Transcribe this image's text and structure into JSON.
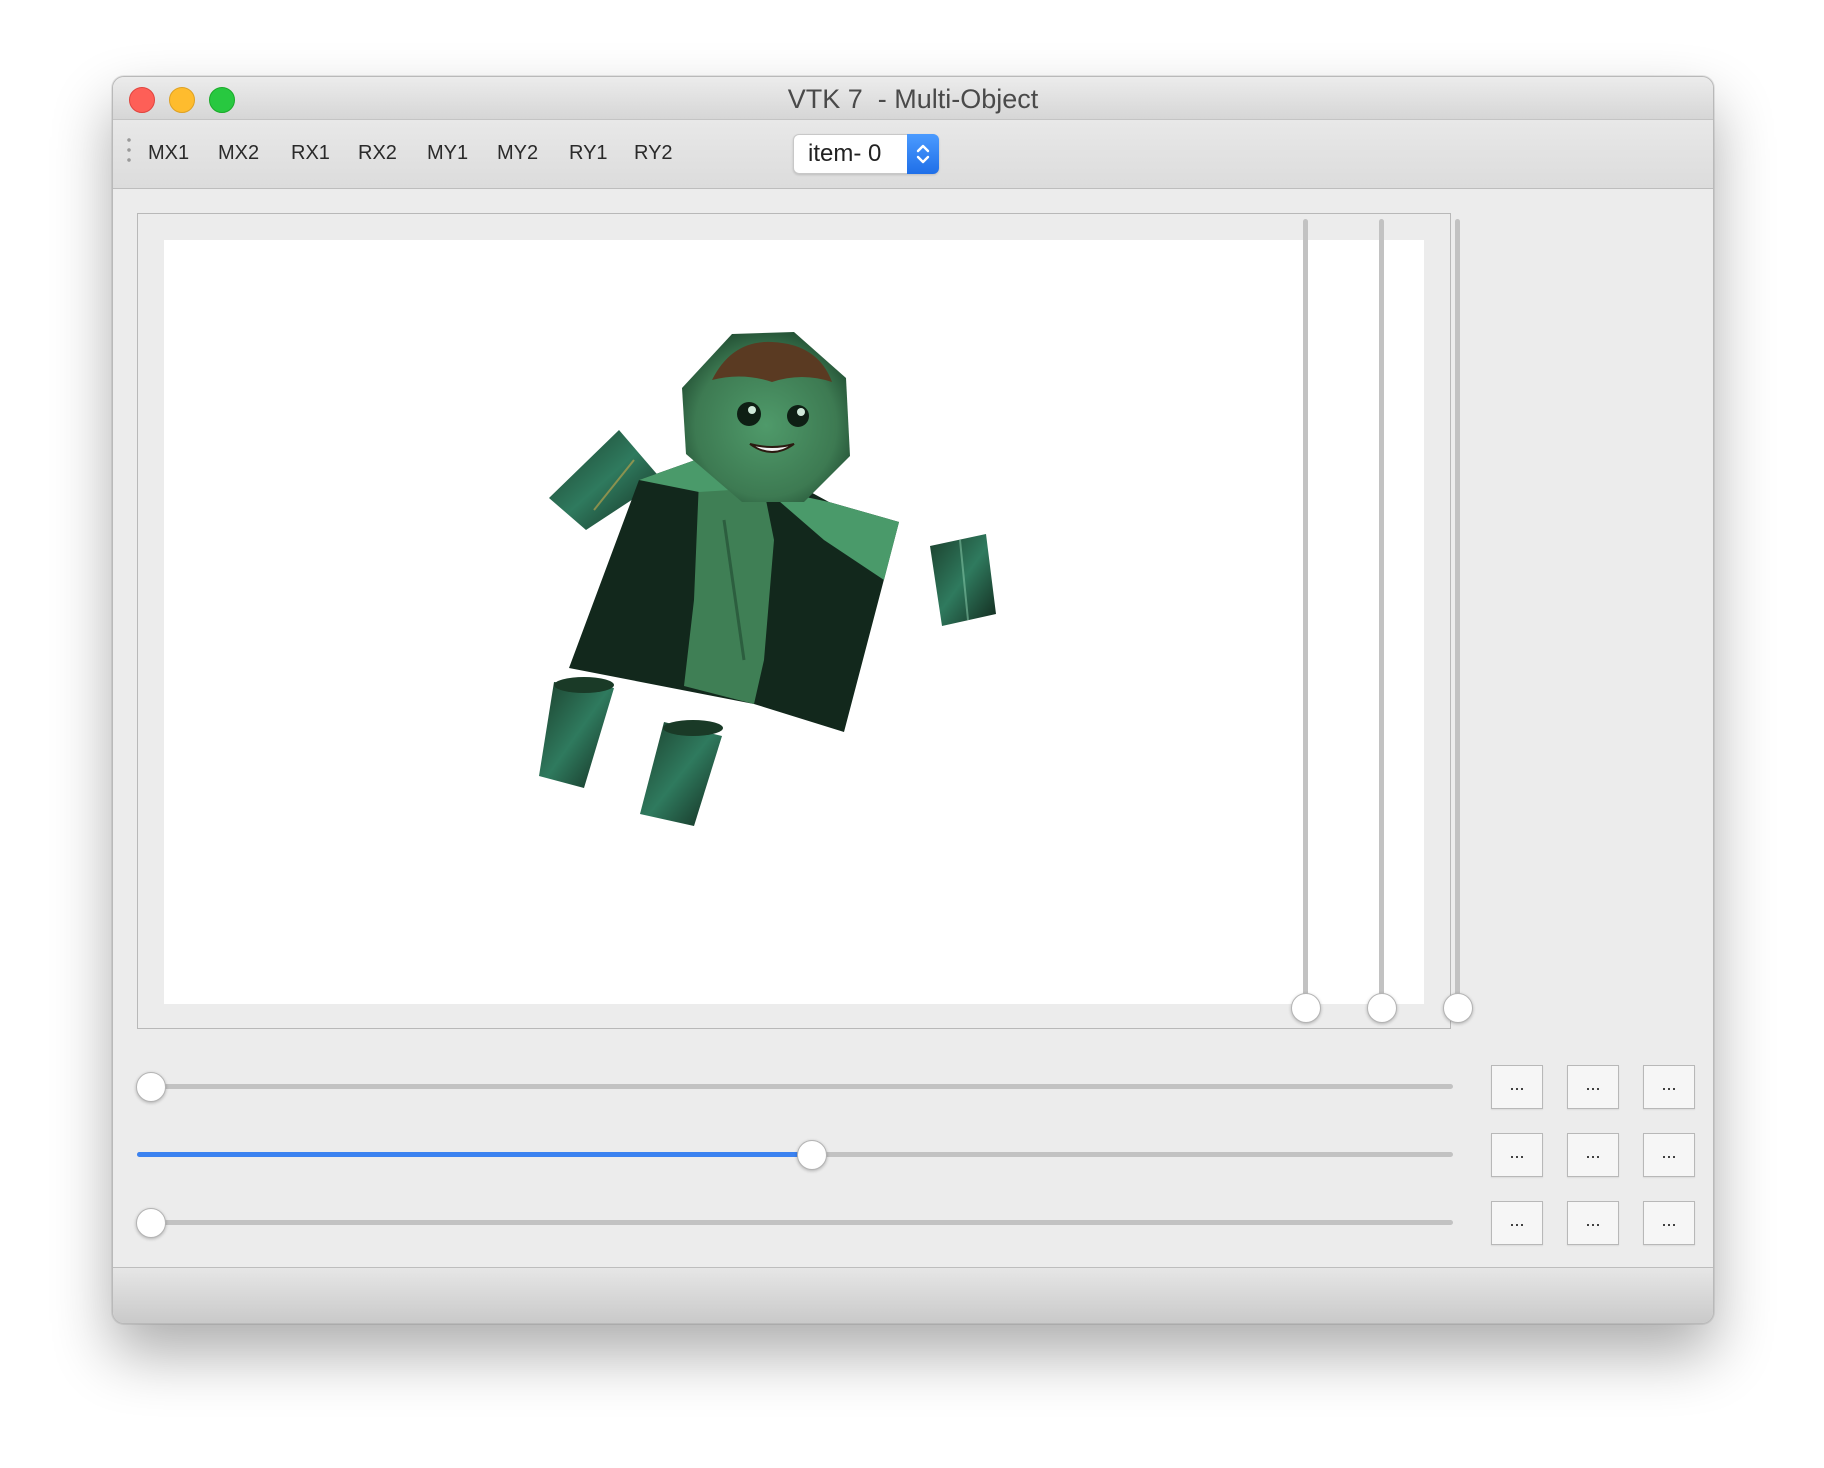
{
  "window": {
    "title": "VTK 7  - Multi-Object"
  },
  "toolbar": {
    "buttons": [
      "MX1",
      "MX2",
      "RX1",
      "RX2",
      "MY1",
      "MY2",
      "RY1",
      "RY2"
    ],
    "item_select": {
      "selected": "item- 0"
    }
  },
  "viewport": {
    "scene": "textured-character-model",
    "colors": {
      "tint": "#3f7f55",
      "background": "#ffffff"
    }
  },
  "vertical_sliders": [
    {
      "value_pct": 0
    },
    {
      "value_pct": 0
    },
    {
      "value_pct": 0
    }
  ],
  "horizontal_sliders": [
    {
      "value_pct": 0
    },
    {
      "value_pct": 50
    },
    {
      "value_pct": 0
    }
  ],
  "button_grid": [
    [
      "...",
      "...",
      "..."
    ],
    [
      "...",
      "...",
      "..."
    ],
    [
      "...",
      "...",
      "..."
    ]
  ],
  "colors": {
    "accent": "#3b82f0",
    "close": "#fe5f57",
    "minimize": "#febc2e",
    "maximize": "#28c840"
  }
}
